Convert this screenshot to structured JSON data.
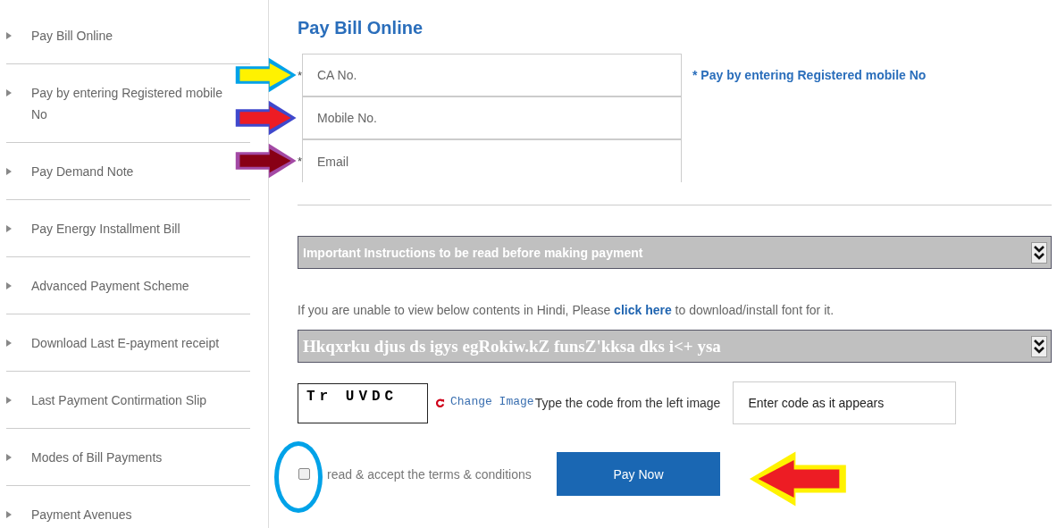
{
  "sidebar": {
    "items": [
      {
        "label": "Pay Bill Online"
      },
      {
        "label": "Pay by entering Registered mobile No"
      },
      {
        "label": "Pay Demand Note"
      },
      {
        "label": "Pay Energy Installment Bill"
      },
      {
        "label": "Advanced Payment Scheme"
      },
      {
        "label": "Download Last E-payment receipt"
      },
      {
        "label": "Last Payment Contirmation Slip"
      },
      {
        "label": "Modes of Bill Payments"
      },
      {
        "label": "Payment Avenues"
      }
    ]
  },
  "title": "Pay Bill Online",
  "fields": [
    {
      "placeholder": "CA No.",
      "required_mark": "*",
      "arrow": {
        "color": "#fff200",
        "border": {
          "color": "#00a2e8"
        }
      }
    },
    {
      "placeholder": "Mobile No.",
      "arrow": {
        "color": "#ed1c24",
        "border": {
          "color": "#3f48cc"
        }
      }
    },
    {
      "placeholder": "Email",
      "required_mark": "*",
      "arrow": {
        "color": "#880015",
        "border": {
          "color": "#a349a4"
        }
      }
    }
  ],
  "fields_note": "* Pay by entering Registered mobile No",
  "instructions_bar": {
    "label": "Important Instructions to be read before making payment",
    "expanded": false
  },
  "hindi_note": "If you are unable to view below contents in Hindi, Please **click here** to download/install font for it.",
  "hindi_bar": {
    "label": "Hkqxrku djus ds igys egRokiw.kZ funsZ'kksa dks i<+ ysa",
    "expanded": false
  },
  "captcha": {
    "code": "Tr UVDC",
    "change_link": "Change Image",
    "hint": "Type the code from the left image",
    "placeholder": "Enter code as it appears"
  },
  "terms": {
    "label": "read & accept the terms & conditions",
    "checked": false,
    "circle": {
      "color": "#00a2e8"
    }
  },
  "pay_button": {
    "label": "Pay Now",
    "arrow": {
      "color": "#ed1c24",
      "border": {
        "color": "#fff200"
      }
    }
  }
}
